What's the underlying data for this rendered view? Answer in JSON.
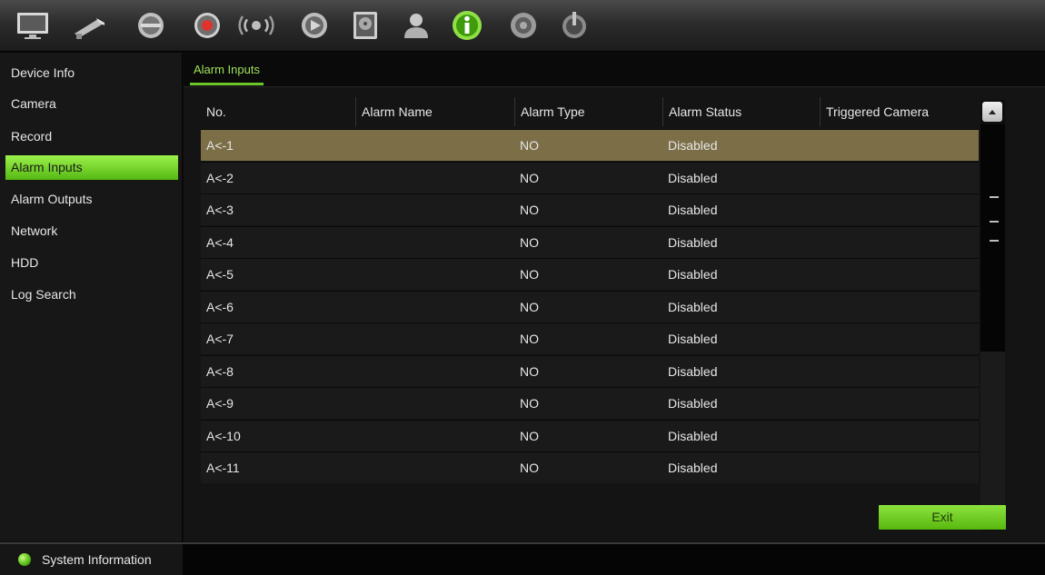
{
  "toolbar": {
    "icons": [
      "monitor-icon",
      "camera-icon",
      "ptz-dome-icon",
      "record-icon",
      "network-icon",
      "playback-icon",
      "hdd-icon",
      "user-icon",
      "system-info-icon",
      "settings-icon",
      "power-icon"
    ]
  },
  "sidebar": {
    "items": [
      {
        "label": "Device Info"
      },
      {
        "label": "Camera"
      },
      {
        "label": "Record"
      },
      {
        "label": "Alarm Inputs"
      },
      {
        "label": "Alarm Outputs"
      },
      {
        "label": "Network"
      },
      {
        "label": "HDD"
      },
      {
        "label": "Log Search"
      }
    ],
    "active_index": 3
  },
  "tab": {
    "label": "Alarm Inputs"
  },
  "table": {
    "columns": [
      "No.",
      "Alarm Name",
      "Alarm Type",
      "Alarm Status",
      "Triggered Camera"
    ],
    "rows": [
      {
        "no": "A<-1",
        "name": "",
        "type": "NO",
        "status": "Disabled",
        "camera": ""
      },
      {
        "no": "A<-2",
        "name": "",
        "type": "NO",
        "status": "Disabled",
        "camera": ""
      },
      {
        "no": "A<-3",
        "name": "",
        "type": "NO",
        "status": "Disabled",
        "camera": ""
      },
      {
        "no": "A<-4",
        "name": "",
        "type": "NO",
        "status": "Disabled",
        "camera": ""
      },
      {
        "no": "A<-5",
        "name": "",
        "type": "NO",
        "status": "Disabled",
        "camera": ""
      },
      {
        "no": "A<-6",
        "name": "",
        "type": "NO",
        "status": "Disabled",
        "camera": ""
      },
      {
        "no": "A<-7",
        "name": "",
        "type": "NO",
        "status": "Disabled",
        "camera": ""
      },
      {
        "no": "A<-8",
        "name": "",
        "type": "NO",
        "status": "Disabled",
        "camera": ""
      },
      {
        "no": "A<-9",
        "name": "",
        "type": "NO",
        "status": "Disabled",
        "camera": ""
      },
      {
        "no": "A<-10",
        "name": "",
        "type": "NO",
        "status": "Disabled",
        "camera": ""
      },
      {
        "no": "A<-11",
        "name": "",
        "type": "NO",
        "status": "Disabled",
        "camera": ""
      }
    ],
    "selected_index": 0
  },
  "exit_label": "Exit",
  "status": {
    "label": "System Information"
  },
  "colors": {
    "accent_green": "#7ed52f",
    "selected_row": "#7c6f48",
    "background": "#141414"
  }
}
